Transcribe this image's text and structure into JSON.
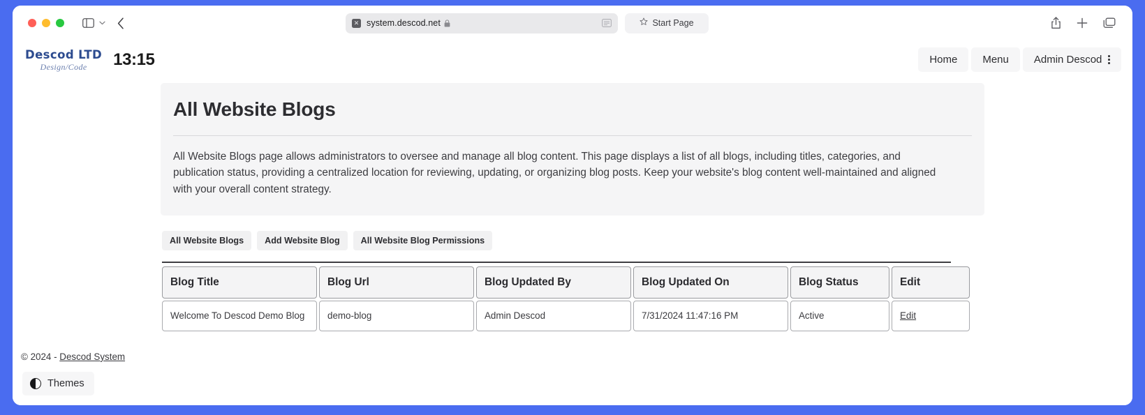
{
  "browser": {
    "traffic_lights": [
      "close",
      "minimize",
      "maximize"
    ],
    "url_bar": {
      "extension_glyph": "✕",
      "url": "system.descod.net",
      "lock_icon": "lock-icon",
      "reader_icon": "reader-view-icon"
    },
    "start_page": {
      "star_icon": "star-icon",
      "label": "Start Page"
    },
    "right_icons": [
      "share-icon",
      "new-tab-icon",
      "tab-overview-icon"
    ],
    "back_icon": "back-chevron-icon",
    "sidebar_icon": "sidebar-toggle-icon",
    "sidebar_chevron": "chevron-down-icon"
  },
  "site_header": {
    "logo_main": "Descod LTD",
    "logo_sub": "Design/Code",
    "clock": "13:15",
    "nav": [
      {
        "label": "Home",
        "name": "nav-home"
      },
      {
        "label": "Menu",
        "name": "nav-menu"
      },
      {
        "label": "Admin Descod",
        "name": "nav-admin-descod",
        "has_kebab": true
      }
    ]
  },
  "jumbotron": {
    "title": "All Website Blogs",
    "description": "All Website Blogs page allows administrators to oversee and manage all blog content. This page displays a list of all blogs, including titles, categories, and publication status, providing a centralized location for reviewing, updating, or organizing blog posts. Keep your website's blog content well-maintained and aligned with your overall content strategy."
  },
  "tabs": [
    {
      "label": "All Website Blogs",
      "name": "tab-all-website-blogs"
    },
    {
      "label": "Add Website Blog",
      "name": "tab-add-website-blog"
    },
    {
      "label": "All Website Blog Permissions",
      "name": "tab-all-website-blog-permissions"
    }
  ],
  "table": {
    "columns": [
      "Blog Title",
      "Blog Url",
      "Blog Updated By",
      "Blog Updated On",
      "Blog Status",
      "Edit"
    ],
    "rows": [
      {
        "title": "Welcome To Descod Demo Blog",
        "url": "demo-blog",
        "updated_by": "Admin Descod",
        "updated_on": "7/31/2024 11:47:16 PM",
        "status": "Active",
        "edit": "Edit"
      }
    ]
  },
  "footer": {
    "copyright": "© 2024 - ",
    "link": "Descod System"
  },
  "themes": {
    "label": "Themes",
    "icon": "contrast-icon"
  },
  "colors": {
    "desktop_background": "#4a6cf0",
    "logo_blue": "#2c4b8f",
    "panel_gray": "#f5f5f6"
  }
}
